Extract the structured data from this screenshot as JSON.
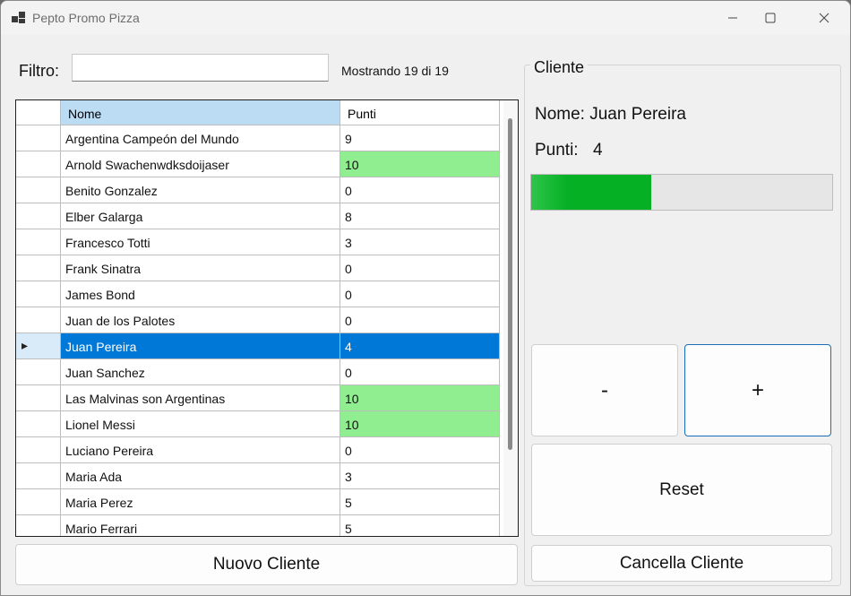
{
  "window": {
    "title": "Pepto Promo Pizza"
  },
  "filter": {
    "label": "Filtro:",
    "value": "",
    "status": "Mostrando 19 di 19"
  },
  "grid": {
    "columns": [
      "Nome",
      "Punti"
    ],
    "rows": [
      {
        "name": "Argentina Campeón del Mundo",
        "points": "9"
      },
      {
        "name": "Arnold Swachenwdksdoijaser",
        "points": "10",
        "highlight": true
      },
      {
        "name": "Benito Gonzalez",
        "points": "0"
      },
      {
        "name": "Elber Galarga",
        "points": "8"
      },
      {
        "name": "Francesco Totti",
        "points": "3"
      },
      {
        "name": "Frank Sinatra",
        "points": "0"
      },
      {
        "name": "James Bond",
        "points": "0"
      },
      {
        "name": "Juan de los Palotes",
        "points": "0"
      },
      {
        "name": "Juan Pereira",
        "points": "4",
        "selected": true
      },
      {
        "name": "Juan Sanchez",
        "points": "0"
      },
      {
        "name": "Las Malvinas son Argentinas",
        "points": "10",
        "highlight": true
      },
      {
        "name": "Lionel Messi",
        "points": "10",
        "highlight": true
      },
      {
        "name": "Luciano Pereira",
        "points": "0"
      },
      {
        "name": "Maria Ada",
        "points": "3"
      },
      {
        "name": "Maria Perez",
        "points": "5"
      },
      {
        "name": "Mario Ferrari",
        "points": "5"
      }
    ]
  },
  "buttons": {
    "new_client": "Nuovo Cliente",
    "delete_client": "Cancella Cliente",
    "minus": "-",
    "plus": "+",
    "reset": "Reset"
  },
  "client": {
    "group_label": "Cliente",
    "name_label": "Nome: Juan Pereira",
    "points_label": "Punti:",
    "points_value": "4",
    "progress_fraction": 0.4
  },
  "colors": {
    "highlight": "#90ee90",
    "selected": "#0078d7",
    "header_selected": "#bcdcf4",
    "progress": "#06b025"
  }
}
